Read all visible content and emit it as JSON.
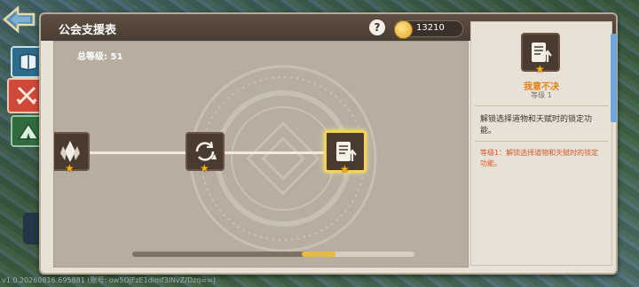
{
  "panel": {
    "title": "公会支援表",
    "help_label": "?",
    "currency_value": "13210",
    "total_level": "总等级: 51"
  },
  "tree": {
    "nodes": [
      {
        "name": "crystal",
        "icon": "crystal-leaf-icon",
        "stars": "★"
      },
      {
        "name": "refresh-upgrade",
        "icon": "cycle-arrow-icon",
        "stars": "★"
      },
      {
        "name": "scroll-upgrade",
        "icon": "scroll-arrow-icon",
        "stars": "★",
        "selected": true
      }
    ],
    "scroll_thumb_fraction": 0.72
  },
  "detail": {
    "icon": "scroll-arrow-icon",
    "star": "★",
    "name": "我意不决",
    "level": "等级 1",
    "description": "解锁选择道物和天赋时的锁定功能。",
    "effect": "等级1：解锁选择道物和天赋时的锁定功能。"
  },
  "version": "v1.0.20260816.695881 (账号: ow5OjFzE1dimf3INvZ/Dzq==)",
  "colors": {
    "accent": "#f4d35a",
    "title_bar": "#4a3d33",
    "highlight": "#e08318"
  }
}
